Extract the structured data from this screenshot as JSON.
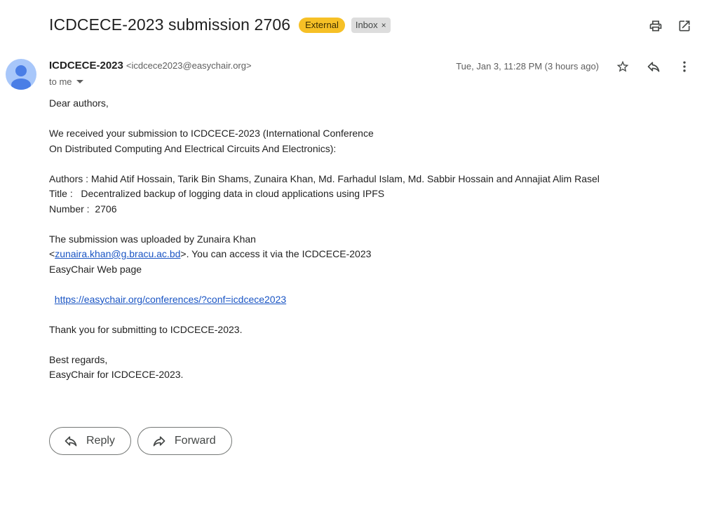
{
  "email": {
    "subject": "ICDCECE-2023 submission 2706",
    "labels": {
      "external": "External",
      "inbox": "Inbox",
      "remove_label": "×"
    },
    "sender": {
      "name": "ICDCECE-2023",
      "address": "<icdcece2023@easychair.org>"
    },
    "recipient": "to me",
    "date": "Tue, Jan 3, 11:28 PM (3 hours ago)",
    "body": {
      "greeting": "Dear authors,",
      "p1_line1": "We received your submission to ICDCECE-2023 (International Conference",
      "p1_line2": "On Distributed Computing And Electrical Circuits And Electronics):",
      "authors": "Authors : Mahid Atif Hossain, Tarik Bin Shams, Zunaira Khan, Md. Farhadul Islam, Md. Sabbir Hossain and Annajiat Alim Rasel",
      "title": "Title :   Decentralized backup of logging data in cloud applications using IPFS",
      "number": "Number :  2706",
      "uploaded_line1": "The submission was uploaded by Zunaira Khan",
      "uploaded_prefix": "<",
      "uploader_email": "zunaira.khan@g.bracu.ac.bd",
      "uploaded_suffix": ">. You can access it via the ICDCECE-2023",
      "uploaded_line3": "EasyChair Web page",
      "url_indent": "  ",
      "url": "https://easychair.org/conferences/?conf=icdcece2023",
      "thanks": "Thank you for submitting to ICDCECE-2023.",
      "closing": "Best regards,",
      "signature": "EasyChair for ICDCECE-2023."
    }
  },
  "actions": {
    "reply": "Reply",
    "forward": "Forward"
  },
  "icons": {
    "print": "print-icon",
    "open_new_window": "open-in-new-icon",
    "star": "star-icon",
    "reply": "reply-icon",
    "more": "more-vert-icon",
    "forward": "forward-icon",
    "avatar": "avatar-icon"
  },
  "colors": {
    "external_badge": "#f6c026",
    "inbox_badge": "#dddddd",
    "link": "#1a55c4",
    "avatar": "#a8c7fa"
  }
}
